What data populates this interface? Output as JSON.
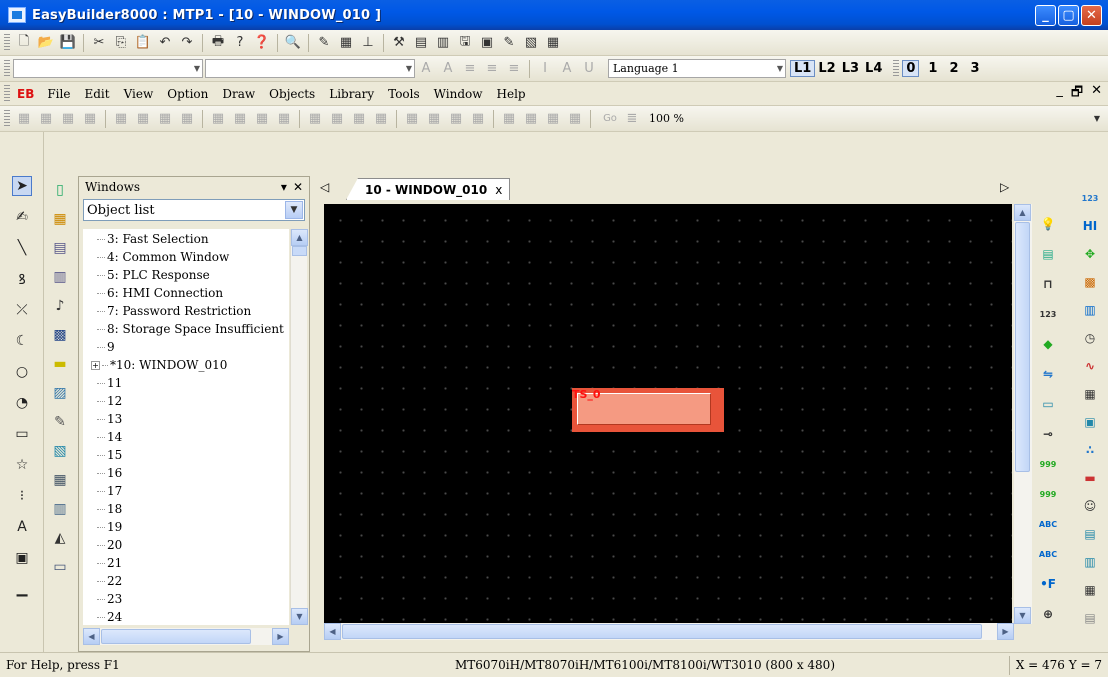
{
  "window": {
    "title": "EasyBuilder8000 : MTP1 - [10 - WINDOW_010 ]",
    "controls": [
      "_",
      "▢",
      "✕"
    ]
  },
  "toolbar1": {
    "icons": [
      "new-icon",
      "open-icon",
      "save-icon",
      "cut-icon",
      "copy-icon",
      "paste-icon",
      "undo-icon",
      "redo-icon",
      "print-icon",
      "help-icon",
      "context-help-icon",
      "find-icon",
      "pen-icon",
      "grid-icon",
      "align-icon",
      "tools-icon",
      "compile-icon",
      "online-sim-icon",
      "offline-sim-icon",
      "download-icon",
      "pen2-icon",
      "picture-icon",
      "table-icon"
    ],
    "glyphs": [
      "🗋",
      "📂",
      "💾",
      "✂",
      "⎘",
      "📋",
      "↶",
      "↷",
      "🖶",
      "?",
      "❓",
      "🔍",
      "✎",
      "▦",
      "⊥",
      "⚒",
      "▤",
      "▥",
      "🖫",
      "▣",
      "✎",
      "▧",
      "▦"
    ]
  },
  "toolbar2": {
    "font_combo": "",
    "size_combo": "",
    "language": "Language 1",
    "layers": [
      "L1",
      "L2",
      "L3",
      "L4"
    ],
    "states": [
      "0",
      "1",
      "2",
      "3"
    ]
  },
  "menubar": {
    "logo": "EB",
    "items": [
      "File",
      "Edit",
      "View",
      "Option",
      "Draw",
      "Objects",
      "Library",
      "Tools",
      "Window",
      "Help"
    ],
    "mdi_controls": [
      "_",
      "🗗",
      "✕"
    ]
  },
  "toolbar3": {
    "zoom": "100 %",
    "go_label": "Go"
  },
  "left_tools": {
    "glyphs": [
      "➤",
      "✍",
      "╲",
      "ꝸ",
      "⤫",
      "☾",
      "○",
      "◔",
      "▭",
      "☆",
      "⁝",
      "A",
      "▣",
      "▁"
    ]
  },
  "windows_panel": {
    "title": "Windows",
    "combo_value": "Object list",
    "tree": [
      "3: Fast Selection",
      "4: Common Window",
      "5: PLC Response",
      "6: HMI Connection",
      "7: Password Restriction",
      "8: Storage Space Insufficient",
      "9",
      "*10: WINDOW_010",
      "11",
      "12",
      "13",
      "14",
      "15",
      "16",
      "17",
      "18",
      "19",
      "20",
      "21",
      "22",
      "23",
      "24"
    ],
    "expander": "+"
  },
  "editor": {
    "tab_label": "10 - WINDOW_010",
    "tab_close": "x",
    "nav_left": "◁",
    "nav_right": "▷",
    "object_label": "TS_0"
  },
  "statusbar": {
    "help": "For Help, press F1",
    "model": "MT6070iH/MT8070iH/MT6100i/MT8100i/WT3010 (800 x 480)",
    "coords": "X = 476  Y = 7"
  },
  "colors": {
    "titlebar": "#0058e6",
    "canvas": "#000000",
    "object_fill": "#e8543a",
    "object_label": "#ff1010"
  }
}
